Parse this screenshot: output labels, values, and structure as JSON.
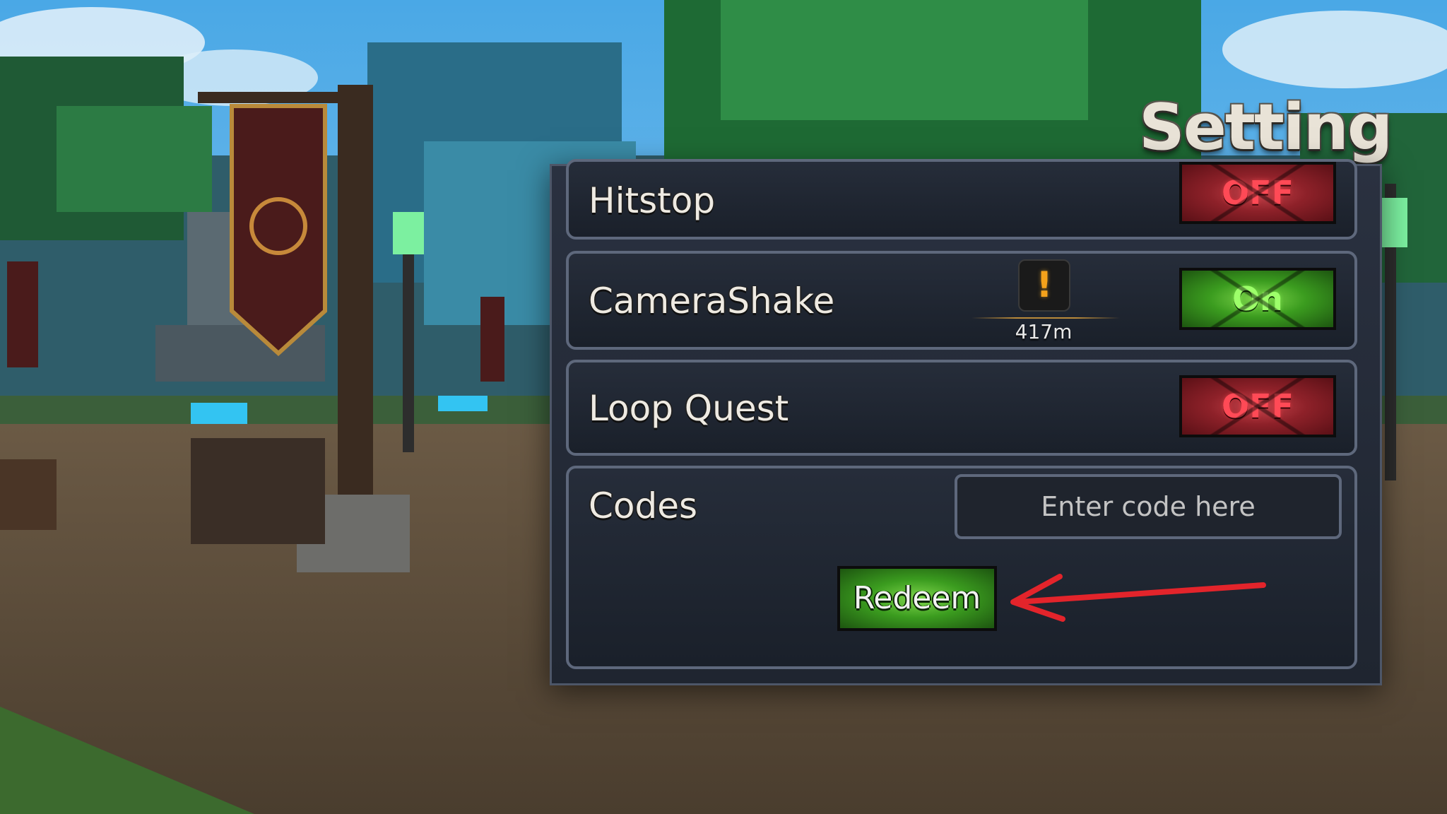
{
  "settings": {
    "title": "Setting",
    "rows": [
      {
        "label": "Hitstop",
        "toggle": "OFF"
      },
      {
        "label": "CameraShake",
        "toggle": "On"
      },
      {
        "label": "Loop Quest",
        "toggle": "OFF"
      }
    ],
    "codes": {
      "label": "Codes",
      "placeholder": "Enter code here",
      "value": "",
      "redeem_label": "Redeem"
    }
  },
  "hud": {
    "alert_symbol": "!",
    "waypoint_distance": "417m"
  },
  "colors": {
    "panel_bg": "#232a36",
    "panel_border": "#5e687c",
    "off_red": "#ff4a56",
    "on_green": "#9dff6a",
    "arrow_red": "#e3242b",
    "alert_orange": "#f4a21b"
  },
  "icons": {
    "alert": "exclamation-icon",
    "annotation": "red-arrow-icon"
  }
}
